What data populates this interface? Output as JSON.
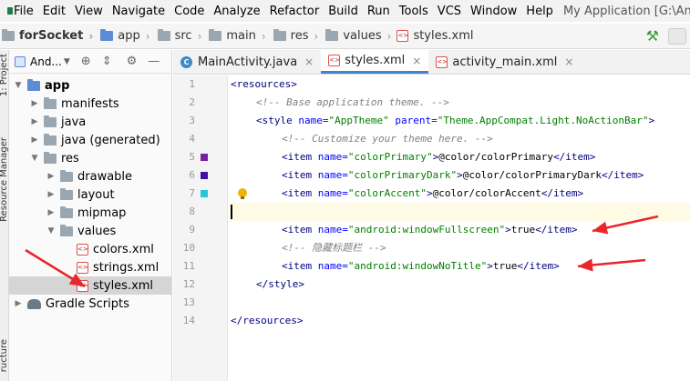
{
  "menubar": {
    "items": [
      "File",
      "Edit",
      "View",
      "Navigate",
      "Code",
      "Analyze",
      "Refactor",
      "Build",
      "Run",
      "Tools",
      "VCS",
      "Window",
      "Help"
    ],
    "window_title": "My Application [G:\\Andro"
  },
  "navbar": {
    "crumbs": [
      "forSocket",
      "app",
      "src",
      "main",
      "res",
      "values",
      "styles.xml"
    ]
  },
  "toolstrip": {
    "project_label": "1: Project",
    "resource_label": "Resource Manager",
    "structure_label": "ructure"
  },
  "project": {
    "view_label": "And..."
  },
  "tree": [
    {
      "label": "app",
      "depth": 0,
      "expanded": true,
      "icon": "module-folder"
    },
    {
      "label": "manifests",
      "depth": 1,
      "expanded": false,
      "icon": "folder"
    },
    {
      "label": "java",
      "depth": 1,
      "expanded": false,
      "icon": "folder"
    },
    {
      "label": "java (generated)",
      "depth": 1,
      "expanded": false,
      "icon": "folder"
    },
    {
      "label": "res",
      "depth": 1,
      "expanded": true,
      "icon": "folder"
    },
    {
      "label": "drawable",
      "depth": 2,
      "expanded": false,
      "icon": "folder"
    },
    {
      "label": "layout",
      "depth": 2,
      "expanded": false,
      "icon": "folder"
    },
    {
      "label": "mipmap",
      "depth": 2,
      "expanded": false,
      "icon": "folder"
    },
    {
      "label": "values",
      "depth": 2,
      "expanded": true,
      "icon": "folder"
    },
    {
      "label": "colors.xml",
      "depth": 3,
      "icon": "xml"
    },
    {
      "label": "strings.xml",
      "depth": 3,
      "icon": "xml"
    },
    {
      "label": "styles.xml",
      "depth": 3,
      "icon": "xml",
      "selected": true
    },
    {
      "label": "Gradle Scripts",
      "depth": 0,
      "expanded": false,
      "icon": "gradle"
    }
  ],
  "tabs": [
    {
      "label": "MainActivity.java",
      "icon": "class",
      "active": false
    },
    {
      "label": "styles.xml",
      "icon": "xml",
      "active": true
    },
    {
      "label": "activity_main.xml",
      "icon": "xml",
      "active": false
    }
  ],
  "code": {
    "lines": [
      {
        "n": "1",
        "indent": 0,
        "parts": [
          [
            "tag",
            "<resources>"
          ]
        ]
      },
      {
        "n": "2",
        "indent": 1,
        "parts": [
          [
            "comment",
            "<!-- Base application theme. -->"
          ]
        ]
      },
      {
        "n": "3",
        "indent": 1,
        "parts": [
          [
            "tag",
            "<style "
          ],
          [
            "attr",
            "name="
          ],
          [
            "val",
            "\"AppTheme\" "
          ],
          [
            "attr",
            "parent="
          ],
          [
            "val",
            "\"Theme.AppCompat.Light.NoActionBar\""
          ],
          [
            "tag",
            ">"
          ]
        ]
      },
      {
        "n": "4",
        "indent": 2,
        "parts": [
          [
            "comment",
            "<!-- Customize your theme here. -->"
          ]
        ]
      },
      {
        "n": "5",
        "indent": 2,
        "swatch": "#7b1fa2",
        "parts": [
          [
            "tag",
            "<item "
          ],
          [
            "attr",
            "name="
          ],
          [
            "val",
            "\"colorPrimary\""
          ],
          [
            "tag",
            ">"
          ],
          [
            "txt",
            "@color/colorPrimary"
          ],
          [
            "tag",
            "</item>"
          ]
        ]
      },
      {
        "n": "6",
        "indent": 2,
        "swatch": "#3f0fa6",
        "parts": [
          [
            "tag",
            "<item "
          ],
          [
            "attr",
            "name="
          ],
          [
            "val",
            "\"colorPrimaryDark\""
          ],
          [
            "tag",
            ">"
          ],
          [
            "txt",
            "@color/colorPrimaryDark"
          ],
          [
            "tag",
            "</item>"
          ]
        ]
      },
      {
        "n": "7",
        "indent": 2,
        "swatch": "#26c6da",
        "bulb": true,
        "parts": [
          [
            "tag",
            "<item "
          ],
          [
            "attr",
            "name="
          ],
          [
            "val",
            "\"colorAccent\""
          ],
          [
            "tag",
            ">"
          ],
          [
            "txt",
            "@color/colorAccent"
          ],
          [
            "tag",
            "</item>"
          ]
        ]
      },
      {
        "n": "8",
        "indent": 0,
        "current": true,
        "parts": []
      },
      {
        "n": "9",
        "indent": 2,
        "parts": [
          [
            "tag",
            "<item "
          ],
          [
            "attr",
            "name="
          ],
          [
            "val",
            "\"android:windowFullscreen\""
          ],
          [
            "tag",
            ">"
          ],
          [
            "txt",
            "true"
          ],
          [
            "tag",
            "</item>"
          ]
        ]
      },
      {
        "n": "10",
        "indent": 2,
        "parts": [
          [
            "comment",
            "<!-- 隐藏标题栏 -->"
          ]
        ]
      },
      {
        "n": "11",
        "indent": 2,
        "parts": [
          [
            "tag",
            "<item "
          ],
          [
            "attr",
            "name="
          ],
          [
            "val",
            "\"android:windowNoTitle\""
          ],
          [
            "tag",
            ">"
          ],
          [
            "txt",
            "true"
          ],
          [
            "tag",
            "</item>"
          ]
        ]
      },
      {
        "n": "12",
        "indent": 1,
        "parts": [
          [
            "tag",
            "</style>"
          ]
        ]
      },
      {
        "n": "13",
        "indent": 0,
        "parts": []
      },
      {
        "n": "14",
        "indent": 0,
        "parts": [
          [
            "tag",
            "</resources>"
          ]
        ]
      }
    ]
  },
  "colors": {
    "annotation_arrow": "#e8262b",
    "tab_underline": "#4083c9",
    "selection": "#d5d5d5"
  }
}
